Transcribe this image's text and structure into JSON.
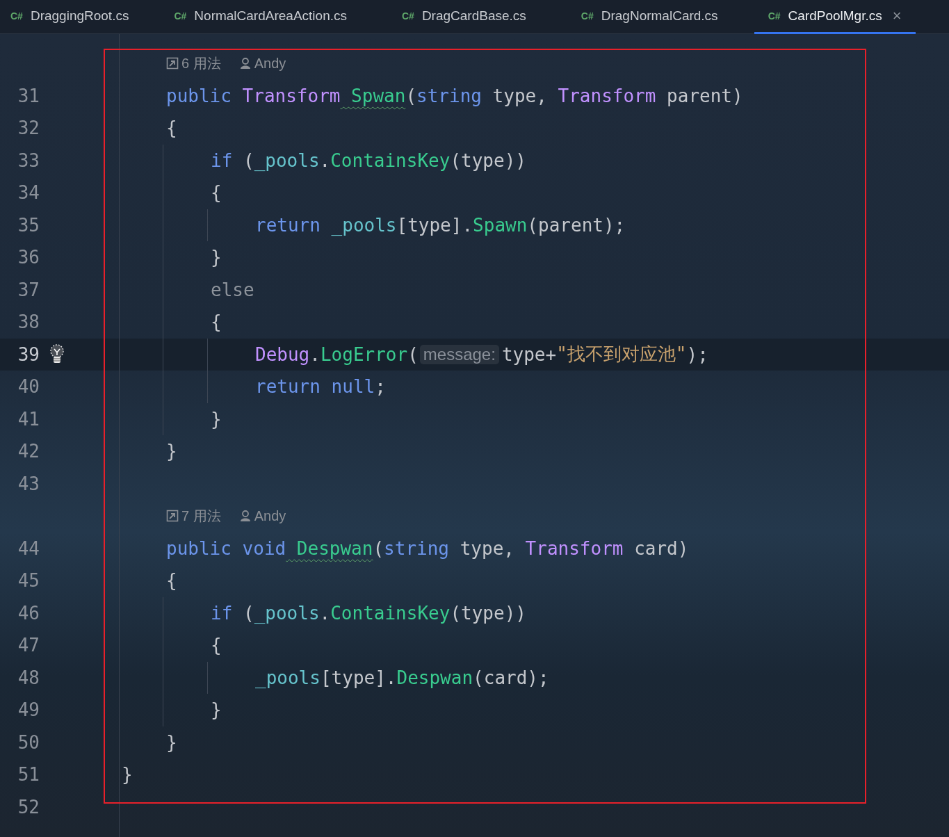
{
  "tabs": [
    {
      "badge": "C#",
      "label": "DraggingRoot.cs",
      "selected": false
    },
    {
      "badge": "C#",
      "label": "NormalCardAreaAction.cs",
      "selected": false
    },
    {
      "badge": "C#",
      "label": "DragCardBase.cs",
      "selected": false
    },
    {
      "badge": "C#",
      "label": "DragNormalCard.cs",
      "selected": false
    },
    {
      "badge": "C#",
      "label": "CardPoolMgr.cs",
      "selected": true,
      "close": "×"
    }
  ],
  "lines": [
    {
      "inlay": {
        "usages": "6 用法",
        "author": "Andy"
      },
      "number": "31",
      "current": false,
      "tokens": [
        {
          "kind": "kw",
          "text": "public"
        },
        {
          "kind": "type",
          "text": " Transform"
        },
        {
          "kind": "fn",
          "text": " Spwan",
          "warning": true
        },
        {
          "kind": "plain",
          "text": "("
        },
        {
          "kind": "kw",
          "text": "string"
        },
        {
          "kind": "plain",
          "text": " type, "
        },
        {
          "kind": "type",
          "text": "Transform"
        },
        {
          "kind": "plain",
          "text": " parent)"
        }
      ]
    },
    {
      "number": "32",
      "current": false,
      "tokens": [
        {
          "kind": "plain",
          "text": "{"
        }
      ]
    },
    {
      "number": "33",
      "current": false,
      "tokens": [
        {
          "kind": "kw",
          "text": "if"
        },
        {
          "kind": "plain",
          "text": " ("
        },
        {
          "kind": "field",
          "text": "_pools"
        },
        {
          "kind": "plain",
          "text": "."
        },
        {
          "kind": "fn",
          "text": "ContainsKey"
        },
        {
          "kind": "plain",
          "text": "(type))"
        }
      ]
    },
    {
      "number": "34",
      "current": false,
      "tokens": [
        {
          "kind": "plain",
          "text": "{"
        }
      ]
    },
    {
      "number": "35",
      "current": false,
      "tokens": [
        {
          "kind": "kw",
          "text": "return"
        },
        {
          "kind": "field",
          "text": " _pools"
        },
        {
          "kind": "plain",
          "text": "[type]."
        },
        {
          "kind": "fn",
          "text": "Spawn"
        },
        {
          "kind": "plain",
          "text": "(parent);"
        }
      ]
    },
    {
      "number": "36",
      "current": false,
      "tokens": [
        {
          "kind": "plain",
          "text": "}"
        }
      ]
    },
    {
      "number": "37",
      "current": false,
      "tokens": [
        {
          "kind": "muted",
          "text": "else"
        }
      ]
    },
    {
      "number": "38",
      "current": false,
      "tokens": [
        {
          "kind": "plain",
          "text": "{"
        }
      ]
    },
    {
      "number": "39",
      "current": true,
      "tokens": [
        {
          "kind": "type",
          "text": "Debug"
        },
        {
          "kind": "plain",
          "text": "."
        },
        {
          "kind": "fn",
          "text": "LogError"
        },
        {
          "kind": "plain",
          "text": "("
        },
        {
          "kind": "hint",
          "text": "message:"
        },
        {
          "kind": "plain",
          "text": "type+"
        },
        {
          "kind": "str",
          "text": "\"找不到对应池\""
        },
        {
          "kind": "plain",
          "text": ");"
        }
      ]
    },
    {
      "number": "40",
      "current": false,
      "tokens": [
        {
          "kind": "kw",
          "text": "return"
        },
        {
          "kind": "kw",
          "text": " null"
        },
        {
          "kind": "plain",
          "text": ";"
        }
      ]
    },
    {
      "number": "41",
      "current": false,
      "tokens": [
        {
          "kind": "plain",
          "text": "}"
        }
      ]
    },
    {
      "number": "42",
      "current": false,
      "tokens": [
        {
          "kind": "plain",
          "text": "}"
        }
      ]
    },
    {
      "number": "43",
      "current": false
    },
    {
      "inlay": {
        "usages": "7 用法",
        "author": "Andy"
      },
      "number": "44",
      "current": false,
      "tokens": [
        {
          "kind": "kw",
          "text": "public"
        },
        {
          "kind": "kw",
          "text": " void"
        },
        {
          "kind": "fn",
          "text": " Despwan",
          "warning": true
        },
        {
          "kind": "plain",
          "text": "("
        },
        {
          "kind": "kw",
          "text": "string"
        },
        {
          "kind": "plain",
          "text": " type, "
        },
        {
          "kind": "type",
          "text": "Transform"
        },
        {
          "kind": "plain",
          "text": " card)"
        }
      ]
    },
    {
      "number": "45",
      "current": false,
      "tokens": [
        {
          "kind": "plain",
          "text": "{"
        }
      ]
    },
    {
      "number": "46",
      "current": false,
      "tokens": [
        {
          "kind": "kw",
          "text": "if"
        },
        {
          "kind": "plain",
          "text": " ("
        },
        {
          "kind": "field",
          "text": "_pools"
        },
        {
          "kind": "plain",
          "text": "."
        },
        {
          "kind": "fn",
          "text": "ContainsKey"
        },
        {
          "kind": "plain",
          "text": "(type))"
        }
      ]
    },
    {
      "number": "47",
      "current": false,
      "tokens": [
        {
          "kind": "plain",
          "text": "{"
        }
      ]
    },
    {
      "number": "48",
      "current": false,
      "tokens": [
        {
          "kind": "field",
          "text": "_pools"
        },
        {
          "kind": "plain",
          "text": "[type]."
        },
        {
          "kind": "fn",
          "text": "Despwan"
        },
        {
          "kind": "plain",
          "text": "(card);"
        }
      ]
    },
    {
      "number": "49",
      "current": false,
      "tokens": [
        {
          "kind": "plain",
          "text": "}"
        }
      ]
    },
    {
      "number": "50",
      "current": false,
      "tokens": [
        {
          "kind": "plain",
          "text": "}"
        }
      ]
    },
    {
      "number": "51",
      "current": false,
      "tokens": [
        {
          "kind": "plain",
          "text": "}"
        }
      ]
    },
    {
      "number": "52",
      "current": false
    }
  ]
}
